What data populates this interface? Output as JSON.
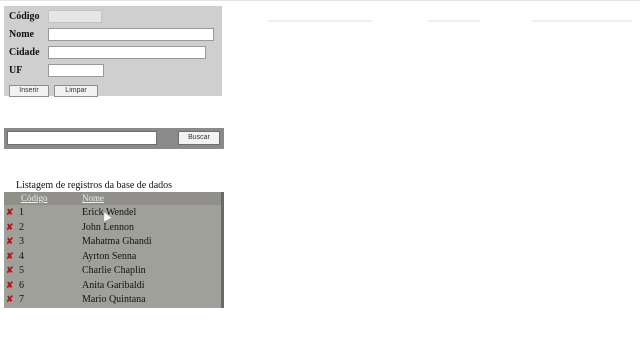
{
  "form": {
    "codigo_label": "Código",
    "codigo_value": "",
    "nome_label": "Nome",
    "nome_value": "",
    "cidade_label": "Cidade",
    "cidade_value": "",
    "uf_label": "UF",
    "uf_value": "",
    "inserir_label": "Inserir",
    "limpar_label": "Limpar"
  },
  "search": {
    "value": "",
    "button_label": "Buscar"
  },
  "listing": {
    "caption": "Listagem de registros da base de dados",
    "columns": [
      "Código",
      "Nome"
    ],
    "delete_icon": "delete-x-icon",
    "delete_color": "#b01818",
    "rows": [
      {
        "code": "1",
        "name": "Erick Wendel"
      },
      {
        "code": "2",
        "name": "John Lennon"
      },
      {
        "code": "3",
        "name": "Mahatma Ghandi"
      },
      {
        "code": "4",
        "name": "Ayrton Senna"
      },
      {
        "code": "5",
        "name": "Charlie Chaplin"
      },
      {
        "code": "6",
        "name": "Anita Garibaldi"
      },
      {
        "code": "7",
        "name": "Mario Quintana"
      }
    ]
  }
}
